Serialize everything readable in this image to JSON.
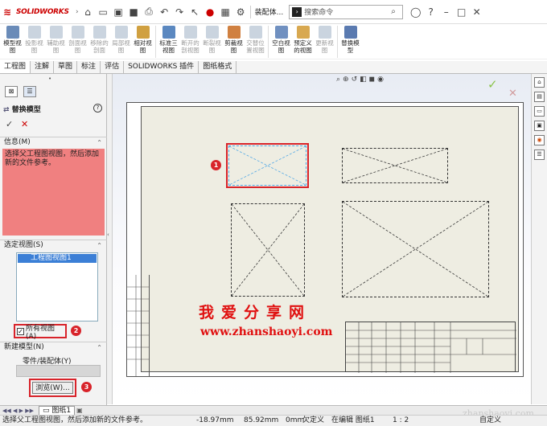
{
  "app": {
    "logo": "SOLIDWORKS",
    "doc_title": "装配体...",
    "search_placeholder": "搜索命令"
  },
  "ribbon": {
    "items": [
      {
        "label": "模型视图",
        "enabled": true
      },
      {
        "label": "投影视图",
        "enabled": false
      },
      {
        "label": "辅助视图",
        "enabled": false
      },
      {
        "label": "剖面视图",
        "enabled": false
      },
      {
        "label": "移除的剖面",
        "enabled": false
      },
      {
        "label": "局部视图",
        "enabled": false
      },
      {
        "label": "相对视图",
        "enabled": true
      },
      {
        "label": "标准三视图",
        "enabled": true
      },
      {
        "label": "断开的剖视图",
        "enabled": false
      },
      {
        "label": "断裂视图",
        "enabled": false
      },
      {
        "label": "剪裁视图",
        "enabled": true
      },
      {
        "label": "交替位置视图",
        "enabled": false
      },
      {
        "label": "空白视图",
        "enabled": true
      },
      {
        "label": "预定义的视图",
        "enabled": true
      },
      {
        "label": "更新视图",
        "enabled": false
      },
      {
        "label": "替换模型",
        "enabled": true
      }
    ]
  },
  "tabs": [
    "工程图",
    "注解",
    "草图",
    "标注",
    "评估",
    "SOLIDWORKS 插件",
    "图纸格式"
  ],
  "panel": {
    "title": "替换模型",
    "help": "?",
    "info_header": "信息(M)",
    "info_text": "选择父工程图视图，然后添加新的文件参考。",
    "selected_views_header": "选定视图(S)",
    "selected_view_item": "工程图视图1",
    "all_views_label": "所有视图(A)",
    "new_model_header": "新建模型(N)",
    "part_assembly_label": "零件/装配体(Y)",
    "browse_label": "浏览(W)..."
  },
  "markers": [
    "1",
    "2",
    "3"
  ],
  "watermark": {
    "line1": "我爱分享网",
    "line2": "www.zhanshaoyi.com",
    "corner": "zhanshaoyi.com"
  },
  "sheet_tabs": {
    "current": "图纸1"
  },
  "status": {
    "message": "选择父工程图视图，然后添加新的文件参考。",
    "x": "-18.97mm",
    "y": "85.92mm",
    "z": "0mm",
    "constraint": "欠定义",
    "editing": "在编辑 图纸1",
    "scale": "1 : 2",
    "units": "自定义"
  }
}
